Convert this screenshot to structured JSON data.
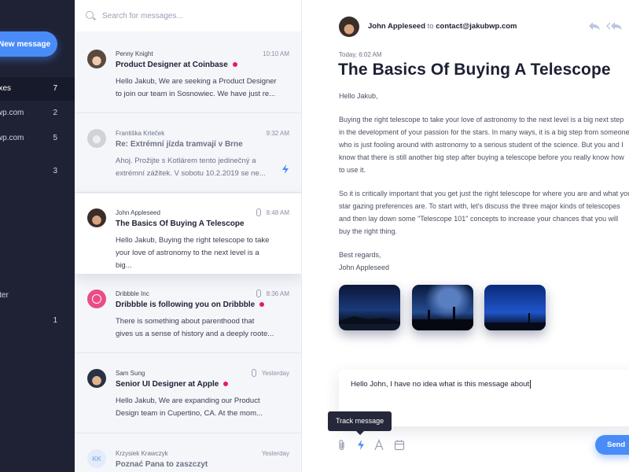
{
  "sidebar": {
    "new_message_label": "New message",
    "items": [
      {
        "label": "Inboxes",
        "count": "7"
      },
      {
        "label": "jakubwp.com",
        "count": "2"
      },
      {
        "label": "jakubwp.com",
        "count": "5"
      },
      {
        "label": "",
        "count": "3"
      },
      {
        "label": "Later",
        "count": ""
      },
      {
        "label": "",
        "count": "1"
      }
    ]
  },
  "search": {
    "placeholder": "Search for messages..."
  },
  "messages": [
    {
      "sender": "Penny Knight",
      "time": "10:10 AM",
      "subject": "Product Designer at Coinbase",
      "unread": true,
      "preview_1": "Hello Jakub, We are seeking a Product Designer",
      "preview_2": "to join our team in Sosnowiec. We have just re..."
    },
    {
      "sender": "Františka Krteček",
      "time": "9:32 AM",
      "subject": "Re: Extrémní jízda tramvají v Brne",
      "unread": false,
      "preview_1": "Ahoj. Prožijte s Kotlárem tento jedinečný a",
      "preview_2": "extrémní zážitek. V sobotu 10.2.2019 se ne..."
    },
    {
      "sender": "John Appleseed",
      "time": "8:48 AM",
      "subject": "The Basics Of Buying A Telescope",
      "unread": false,
      "preview_1": "Hello Jakub, Buying the right telescope to take",
      "preview_2": "your love of astronomy to the next level is a big..."
    },
    {
      "sender": "Dribbble Inc",
      "time": "8:36 AM",
      "subject": "Dribbble is following you on Dribbble",
      "unread": true,
      "preview_1": "There is something about parenthood that",
      "preview_2": "gives us a sense of history and a deeply roote..."
    },
    {
      "sender": "Sam Sung",
      "time": "Yesterday",
      "subject": "Senior UI Designer at Apple",
      "unread": true,
      "preview_1": "Hello Jakub, We are expanding our Product",
      "preview_2": "Design team in Cupertino, CA. At the mom..."
    },
    {
      "sender": "Krzysiek Krawczyk",
      "time": "Yesterday",
      "subject": "Poznać Pana to zaszczyt",
      "initials": "KK"
    }
  ],
  "reader": {
    "from_name": "John Appleseed",
    "to_word": "to",
    "to_email": "contact@jakubwp.com",
    "date": "Today, 6:02 AM",
    "title": "The Basics Of Buying A Telescope",
    "greeting": "Hello Jakub,",
    "p1": [
      "Buying the right telescope to take your love of astronomy to the next level is a big next step",
      "in the development of your passion for the stars. In many ways, it is a big step from someone",
      "who is just fooling around with astronomy to a serious student of the science. But you and I",
      "know that there is still another big step after buying a telescope before you really know how",
      "to use it."
    ],
    "p2": [
      "So it is critically important that you get just the right telescope for where you are and what your",
      "star gazing preferences are. To start with, let's discuss the three major kinds of telescopes",
      "and then lay down some \"Telescope 101\" concepts to increase your chances that you will",
      "buy the right thing."
    ],
    "signoff": "Best regards,",
    "signature": "John Appleseed"
  },
  "compose": {
    "text": "Hello John, I have no idea what is this message about",
    "tooltip": "Track message",
    "send_label": "Send"
  },
  "colors": {
    "accent": "#4a8cf7",
    "unread_dot": "#e6186f",
    "sidebar_bg": "#1f2235"
  }
}
